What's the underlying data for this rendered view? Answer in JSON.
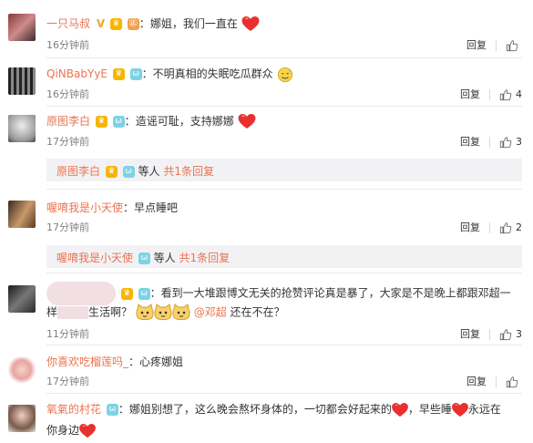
{
  "comments": [
    {
      "user": "一只马叔",
      "text": "娜姐，我们一直在",
      "time": "16分钟前",
      "reply_label": "回复",
      "likes": ""
    },
    {
      "user": "QiNBabYyE",
      "text": "不明真相的失眠吃瓜群众",
      "time": "16分钟前",
      "reply_label": "回复",
      "likes": "4"
    },
    {
      "user": "原图李白",
      "text": "造谣可耻，支持娜娜",
      "time": "17分钟前",
      "reply_label": "回复",
      "likes": "3",
      "sub": {
        "user": "原图李白",
        "mid": "等人",
        "link": "共1条回复"
      }
    },
    {
      "user": "喔唷我是小天使",
      "text": "早点睡吧",
      "time": "17分钟前",
      "reply_label": "回复",
      "likes": "2",
      "sub": {
        "user": "喔唷我是小天使",
        "mid": "等人",
        "link": "共1条回复"
      }
    },
    {
      "user": "",
      "text_a": "看到一大堆跟博文无关的抢赞评论真是暴了，大家是不是晚上都跟邓超一",
      "text_b_pre": "样",
      "text_b_mid": "生活啊？",
      "mention": "@邓超",
      "text_b_post": "还在不在？",
      "time": "11分钟前",
      "reply_label": "回复",
      "likes": "3"
    },
    {
      "user": "你喜欢吃榴莲吗_",
      "text": "心疼娜姐",
      "time": "17分钟前",
      "reply_label": "回复",
      "likes": ""
    },
    {
      "user": "氧氣的村花",
      "text_a": "娜姐别想了，这么晚会熬坏身体的，一切都会好起来的",
      "text_a2": "，早些睡",
      "text_a3": "永远在",
      "text_b": "你身边",
      "time": "",
      "reply_label": "",
      "likes": ""
    }
  ],
  "icons": [
    "thumb-up-icon",
    "heart-icon",
    "vip-v-icon",
    "member-badge-icon",
    "cat-face-emoji",
    "sweat-smile-emoji"
  ],
  "colors": {
    "username": "#eb7350",
    "time": "#808080",
    "reply_bg": "#f2f2f5"
  }
}
